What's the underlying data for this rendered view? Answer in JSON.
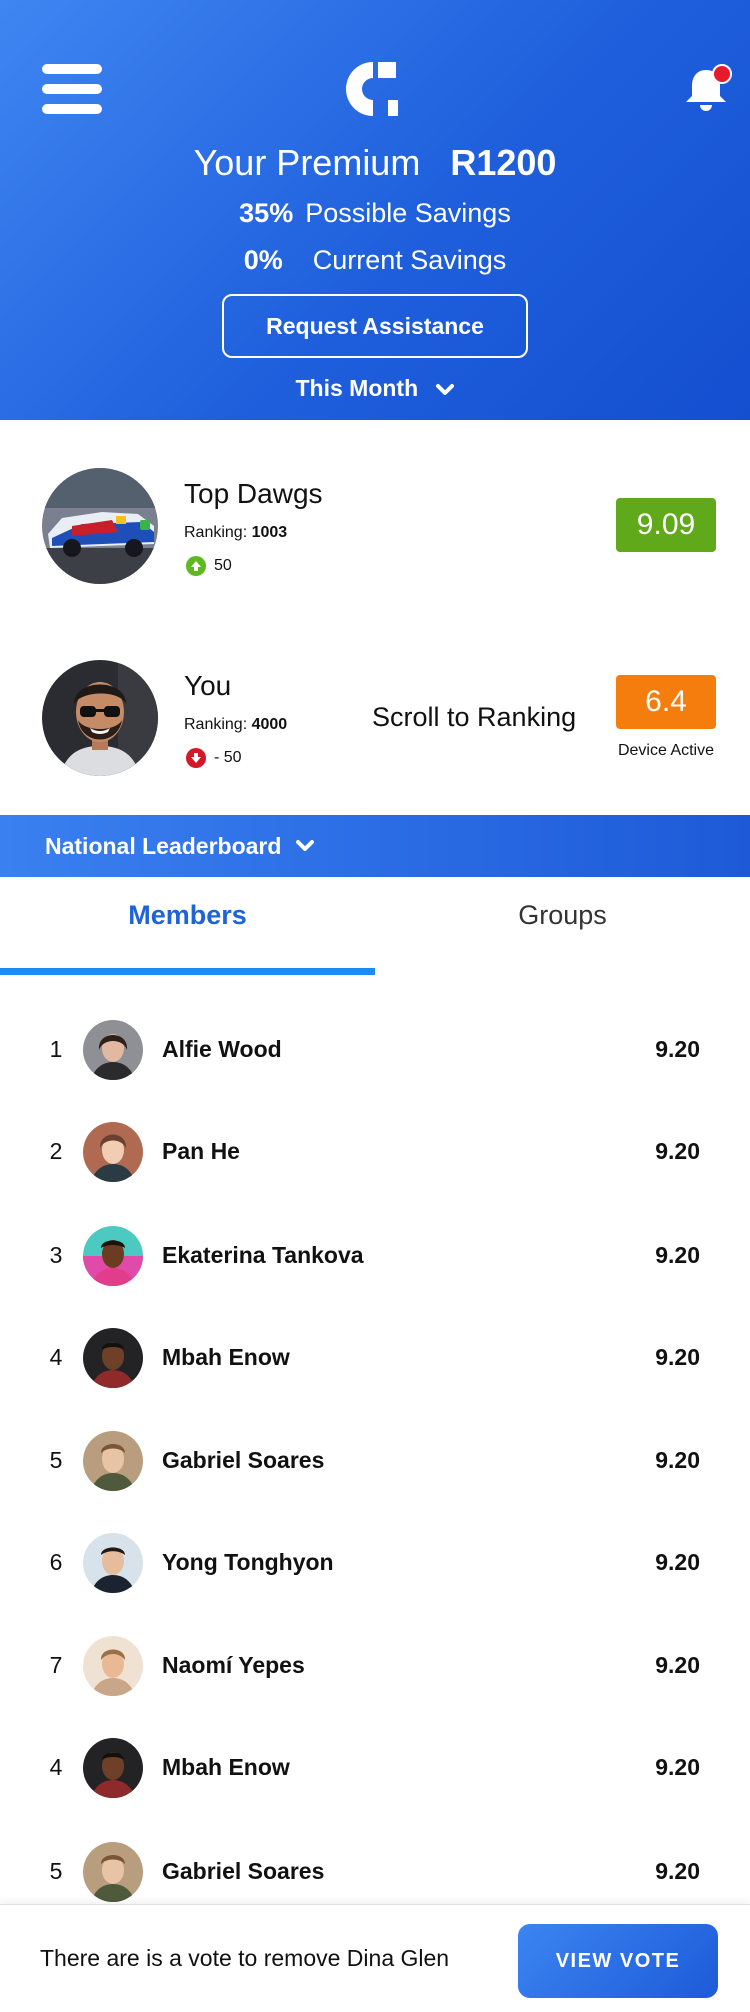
{
  "colors": {
    "header_gradient_start": "#3f86f2",
    "header_gradient_end": "#134fd0",
    "top_score_bg": "#5fa91a",
    "you_score_bg": "#f57d0d",
    "tab_active": "#1f63d9",
    "tab_underline": "#1e8bf5",
    "notification_dot": "#e8192c"
  },
  "header": {
    "menu_icon": "hamburger-menu-icon",
    "logo_icon": "brand-c-logo-icon",
    "bell_icon": "bell-icon",
    "has_notification": true,
    "premium_label": "Your Premium",
    "premium_value": "R1200",
    "possible_savings_pct": "35%",
    "possible_savings_label": "Possible Savings",
    "current_savings_pct": "0%",
    "current_savings_label": "Current Savings",
    "assist_button": "Request Assistance",
    "period": "This Month"
  },
  "top_group": {
    "name": "Top Dawgs",
    "ranking_label": "Ranking:",
    "ranking_value": "1003",
    "delta": "50",
    "delta_direction": "up",
    "score": "9.09"
  },
  "you": {
    "name": "You",
    "ranking_label": "Ranking:",
    "ranking_value": "4000",
    "delta": "- 50",
    "delta_direction": "down",
    "score": "6.4",
    "device_status": "Device Active",
    "scroll_link": "Scroll to Ranking"
  },
  "leaderboard": {
    "title": "National Leaderboard",
    "tabs": [
      "Members",
      "Groups"
    ],
    "active_tab": "Members",
    "rows": [
      {
        "rank": "1",
        "name": "Alfie Wood",
        "score": "9.20"
      },
      {
        "rank": "2",
        "name": "Pan He",
        "score": "9.20"
      },
      {
        "rank": "3",
        "name": "Ekaterina Tankova",
        "score": "9.20"
      },
      {
        "rank": "4",
        "name": "Mbah Enow",
        "score": "9.20"
      },
      {
        "rank": "5",
        "name": "Gabriel Soares",
        "score": "9.20"
      },
      {
        "rank": "6",
        "name": "Yong Tonghyon",
        "score": "9.20"
      },
      {
        "rank": "7",
        "name": "Naomí Yepes",
        "score": "9.20"
      },
      {
        "rank": "4",
        "name": "Mbah Enow",
        "score": "9.20"
      },
      {
        "rank": "5",
        "name": "Gabriel Soares",
        "score": "9.20"
      }
    ]
  },
  "vote_banner": {
    "message": "There are is a vote to remove Dina Glen",
    "button": "VIEW VOTE"
  }
}
